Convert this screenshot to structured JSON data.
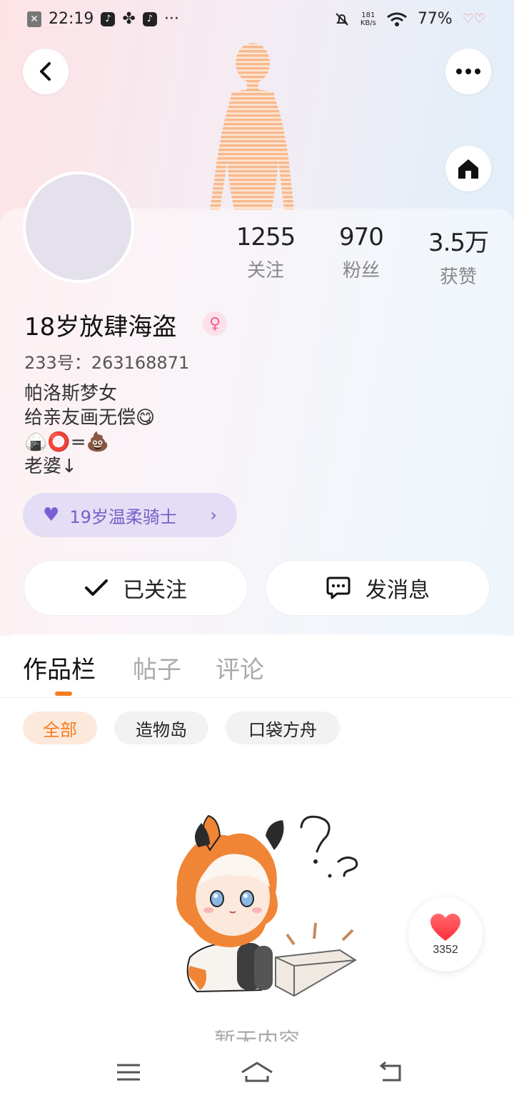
{
  "status_bar": {
    "time": "22:19",
    "dots": "···",
    "speed_value": "181",
    "speed_unit": "KB/s",
    "battery": "77%"
  },
  "profile": {
    "stats": [
      {
        "value": "1255",
        "label": "关注"
      },
      {
        "value": "970",
        "label": "粉丝"
      },
      {
        "value": "3.5万",
        "label": "获赞"
      }
    ],
    "username": "18岁放肆海盗",
    "gender_symbol": "♀",
    "id_line": "233号：263168871",
    "bio": [
      "帕洛斯梦女",
      "给亲友画无偿😋",
      "🍙⭕=💩",
      "老婆↓"
    ],
    "linked_badge": "19岁温柔骑士"
  },
  "actions": {
    "follow_label": "已关注",
    "message_label": "发消息"
  },
  "tabs": [
    {
      "label": "作品栏",
      "active": true
    },
    {
      "label": "帖子",
      "active": false
    },
    {
      "label": "评论",
      "active": false
    }
  ],
  "filters": [
    {
      "label": "全部",
      "active": true
    },
    {
      "label": "造物岛",
      "active": false
    },
    {
      "label": "口袋方舟",
      "active": false
    }
  ],
  "empty_state": {
    "text": "暂无内容"
  },
  "like_float": {
    "count": "3352"
  },
  "colors": {
    "accent": "#f57c1f",
    "badge_purple": "#7560c8",
    "like_red": "#ff4d4f"
  }
}
